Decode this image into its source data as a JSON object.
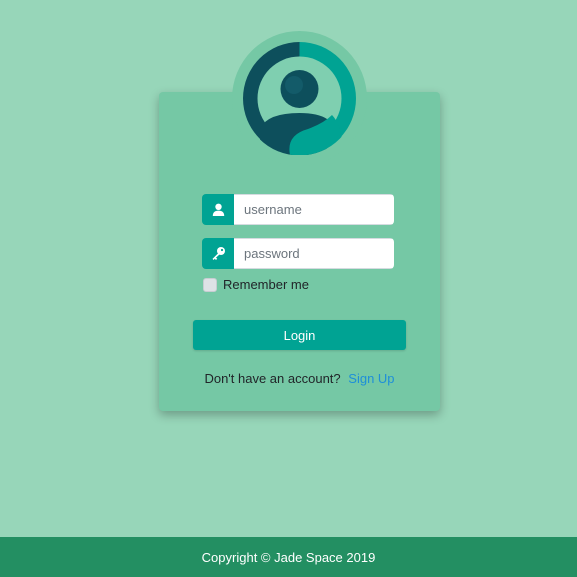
{
  "login_form": {
    "username_placeholder": "username",
    "password_placeholder": "password",
    "remember_label": "Remember me",
    "login_label": "Login",
    "signup_prompt": "Don't have an account?",
    "signup_link": "Sign Up"
  },
  "footer": {
    "copyright": "Copyright © Jade Space 2019"
  },
  "icons": {
    "username": "user-icon",
    "password": "key-icon",
    "avatar": "avatar-icon"
  },
  "colors": {
    "background": "#97d6b9",
    "card": "#75c8a5",
    "accent": "#00a393",
    "footer": "#238f62",
    "link": "#1e8fd8"
  }
}
